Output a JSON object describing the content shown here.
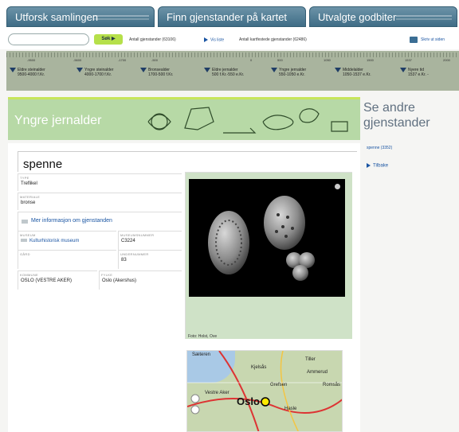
{
  "nav": {
    "tabs": [
      "Utforsk samlingen",
      "Finn gjenstander på kartet",
      "Utvalgte godbiter"
    ]
  },
  "search": {
    "placeholder": "",
    "button_label": "Søk ▶",
    "total_objects": "Antall gjenstander (63106)",
    "show_list": "Vis liste",
    "mapped_objects": "Antall kartfestede gjenstander (62486)",
    "print_page": "Skriv ut siden"
  },
  "timeline": {
    "years": [
      "-9500",
      "-5600",
      "-1700",
      "-500",
      "0",
      "500",
      "1050",
      "1500",
      "1537",
      "2000"
    ],
    "periods": [
      {
        "name": "Eldre steinalder",
        "range": "9500-4000 f.Kr."
      },
      {
        "name": "Yngre steinalder",
        "range": "4000-1700 f.Kr."
      },
      {
        "name": "Bronsealder",
        "range": "1700-500 f.Kr."
      },
      {
        "name": "Eldre jernalder",
        "range": "500 f.Kr.-550 e.Kr."
      },
      {
        "name": "Yngre jernalder",
        "range": "550-1050 e.Kr."
      },
      {
        "name": "Middelalder",
        "range": "1050-1537 e.Kr."
      },
      {
        "name": "Nyere tid",
        "range": "1537 e.Kr. -"
      }
    ]
  },
  "banner": {
    "title": "Yngre jernalder"
  },
  "sidebar": {
    "heading": "Se andre gjenstander",
    "related": "spenne (3352)",
    "back": "Tilbake"
  },
  "object": {
    "title": "spenne",
    "fields": {
      "type_label": "TYPE",
      "type_value": "Treflikel",
      "material_label": "MATERIALE",
      "material_value": "bronse",
      "more_info": "Mer informasjon om gjenstanden",
      "museum_label": "MUSEUM",
      "museum_value": "Kulturhistorisk museum",
      "museum_no_label": "MUSEUMSNUMMER",
      "museum_no_value": "C3224",
      "farm_label": "GÅRD",
      "farm_value": "",
      "under_no_label": "UNDERNUMMER",
      "under_no_value": "83",
      "municipality_label": "KOMMUNE",
      "municipality_value": "OSLO (VESTRE AKER)",
      "county_label": "FYLKE",
      "county_value": "Oslo (Akershus)"
    },
    "photo_caption": "Foto: Holst, Ove"
  },
  "map": {
    "labels": [
      "Sæteren",
      "Kjelsås",
      "Tiller",
      "Ammerud",
      "Vestre Aker",
      "Grefsen",
      "Oslo",
      "Hasle",
      "Romsås"
    ]
  }
}
